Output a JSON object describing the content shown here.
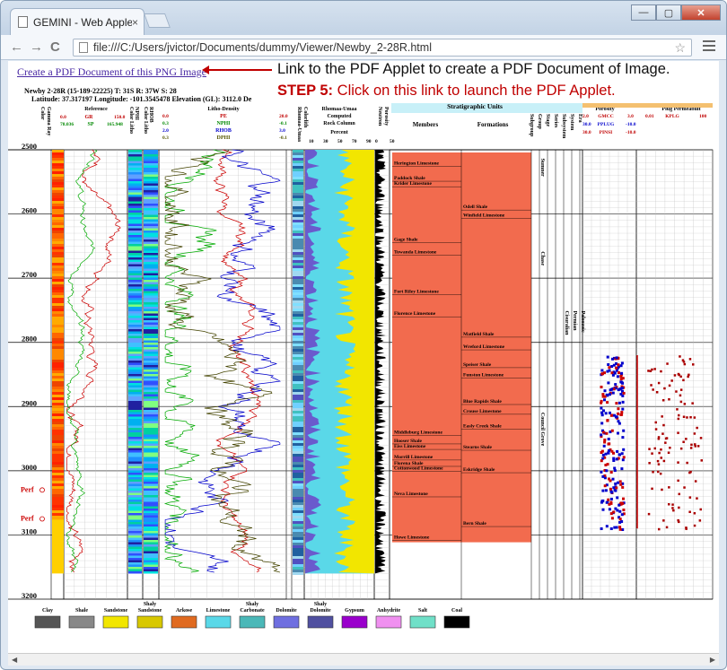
{
  "browser": {
    "tab_title": "GEMINI - Web Apple",
    "tab_close": "×",
    "url": "file:///C:/Users/jvictor/Documents/dummy/Viewer/Newby_2-28R.html",
    "back": "←",
    "forward": "→",
    "reload": "C",
    "star": "☆",
    "minimize": "—",
    "maximize": "▢",
    "close": "✕"
  },
  "page": {
    "pdf_link": "Create a PDF Document of this PNG Image",
    "annotation_line1": "Link to the PDF Applet to create a PDF Document of Image.",
    "annotation_step": "STEP 5:",
    "annotation_line2": " Click on this link to launch the PDF Applet.",
    "well_line1": "Newby 2-28R (15-189-22225) T: 31S R: 37W S: 28",
    "well_line2": "Latitude: 37.317197 Longitude: -101.3545478 Elevation (GL): 3112.0 De"
  },
  "log": {
    "depth_header": "Depth",
    "depths": [
      "2500",
      "2600",
      "2700",
      "2800",
      "2900",
      "3000",
      "3100",
      "3200"
    ],
    "perf_labels": [
      "Perf",
      "Perf"
    ],
    "headers": {
      "gamma": "Gamma Ray",
      "gamma_sub": "Color",
      "reference": "Reference",
      "gr": "GR",
      "gr_min": "0.0",
      "gr_max": "150.0",
      "sp": "SP",
      "sp_min": "78.036",
      "sp_max": "165.948",
      "nphi_col": "NPHI",
      "nphi_col_sub": "Color Litho",
      "rhob_col": "RHOB",
      "rhob_col_sub": "Color Litho",
      "litho_density": "Litho-Density",
      "pe": "PE",
      "pe_min": "0.0",
      "pe_max": "20.0",
      "nphi": "NPHI",
      "nphi_min": "0.3",
      "nphi_max": "-0.1",
      "rhob": "RHOB",
      "rhob_min": "2.0",
      "rhob_max": "3.0",
      "dphi": "DPHI",
      "dphi_min": "0.3",
      "dphi_max": "-0.1",
      "colorlith": "Colorlith",
      "colorlith_sub": "Rhomaa-Umaa",
      "rhomaa": "Rhomaa-Umaa",
      "computed": "Computed",
      "rock_column": "Rock Column",
      "percent": "Percent",
      "percent_ticks": [
        "10",
        "30",
        "50",
        "70",
        "90"
      ],
      "porosity": "Porosity",
      "porosity_sub": "Neutron",
      "porosity_ticks": [
        "0",
        "50"
      ],
      "strat_units": "Stratigraphic Units",
      "members": "Members",
      "formations": "Formations",
      "subgroup": "Subgroup",
      "group": "Group",
      "stage": "Stage",
      "series": "Series",
      "subsystem": "Subsystem",
      "system": "System",
      "era": "Era",
      "porosity_track": "Porosity",
      "gmcc": "GMCC",
      "gmcc_min": "2.0",
      "gmcc_max": "3.0",
      "pplug": "PPLUG",
      "pplug_min": "30.0",
      "pplug_max": "-10.0",
      "pinsi": "PINSI",
      "pinsi_min": "30.0",
      "pinsi_max": "-10.0",
      "perm": "Plug Permeabilit",
      "kplg": "KPLG",
      "kplg_min": "0.01",
      "kplg_max": "100"
    },
    "members": [
      {
        "name": "Herington Limestone",
        "y": 0.035
      },
      {
        "name": "Paddock Shale",
        "y": 0.07
      },
      {
        "name": "Krider Limestone",
        "y": 0.083
      },
      {
        "name": "Gage Shale",
        "y": 0.215
      },
      {
        "name": "Towanda Limestone",
        "y": 0.245
      },
      {
        "name": "Fort Riley Limestone",
        "y": 0.338
      },
      {
        "name": "Florence Limestone",
        "y": 0.39
      },
      {
        "name": "Middleburg Limestone",
        "y": 0.67
      },
      {
        "name": "Hooser Shale",
        "y": 0.69
      },
      {
        "name": "Eiss Limestone",
        "y": 0.703
      },
      {
        "name": "Morrill Limestone",
        "y": 0.728
      },
      {
        "name": "Florena Shale",
        "y": 0.743
      },
      {
        "name": "Cottonwood Limestone",
        "y": 0.755
      },
      {
        "name": "Neva Limestone",
        "y": 0.815
      },
      {
        "name": "Howe Limestone",
        "y": 0.918
      }
    ],
    "formations": [
      {
        "name": "Odell Shale",
        "y": 0.138
      },
      {
        "name": "Winfield Limestone",
        "y": 0.158
      },
      {
        "name": "Matfield Shale",
        "y": 0.438
      },
      {
        "name": "Wreford Limestone",
        "y": 0.468
      },
      {
        "name": "Speiser Shale",
        "y": 0.51
      },
      {
        "name": "Funston Limestone",
        "y": 0.535
      },
      {
        "name": "Blue Rapids Shale",
        "y": 0.597
      },
      {
        "name": "Crouse Limestone",
        "y": 0.62
      },
      {
        "name": "Easly Creek Shale",
        "y": 0.655
      },
      {
        "name": "Stearns Shale",
        "y": 0.705
      },
      {
        "name": "Eskridge Shale",
        "y": 0.758
      },
      {
        "name": "Bern Shale",
        "y": 0.885
      }
    ],
    "groups": [
      {
        "name": "Sumner",
        "y": 0.02,
        "col": 0
      },
      {
        "name": "Chase",
        "y": 0.24,
        "col": 0
      },
      {
        "name": "Council Grove",
        "y": 0.62,
        "col": 0
      },
      {
        "name": "Cisuralian",
        "y": 0.38,
        "col": 1
      },
      {
        "name": "Permian",
        "y": 0.38,
        "col": 2
      },
      {
        "name": "Paleozoic",
        "y": 0.38,
        "col": 3
      }
    ]
  },
  "legend": [
    {
      "label": "Clay",
      "color": "#555555"
    },
    {
      "label": "Shale",
      "color": "#888888"
    },
    {
      "label": "Sandstone",
      "color": "#f2e600"
    },
    {
      "label": "Shaly Sandstone",
      "color": "#d8c800"
    },
    {
      "label": "Arkose",
      "color": "#e06a20"
    },
    {
      "label": "Limestone",
      "color": "#5ad8e8"
    },
    {
      "label": "Shaly Carbonate",
      "color": "#4bb8b8"
    },
    {
      "label": "Dolomite",
      "color": "#6f6fe0"
    },
    {
      "label": "Shaly Dolomite",
      "color": "#5050a0"
    },
    {
      "label": "Gypsum",
      "color": "#9a00cc"
    },
    {
      "label": "Anhydrite",
      "color": "#f090f0"
    },
    {
      "label": "Salt",
      "color": "#70e0c8"
    },
    {
      "label": "Coal",
      "color": "#000000"
    }
  ]
}
